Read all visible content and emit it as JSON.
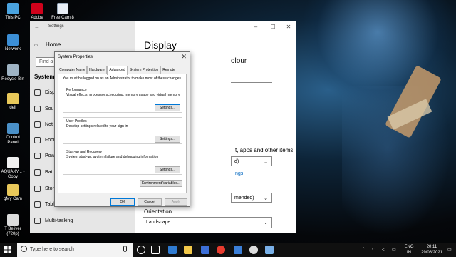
{
  "desktop": {
    "icons": [
      {
        "label": "This PC"
      },
      {
        "label": "Adobe"
      },
      {
        "label": "Free Cam 8"
      },
      {
        "label": "Network"
      },
      {
        "label": "Recycle Bin"
      },
      {
        "label": "dell"
      },
      {
        "label": "Control Panel"
      },
      {
        "label": "AQUAXY... - Copy"
      },
      {
        "label": "gMy Cam"
      },
      {
        "label": "T Beliver (720p)"
      }
    ]
  },
  "settings": {
    "window_title": "Settings",
    "home": "Home",
    "find_placeholder": "Find a s",
    "section": "System",
    "items": [
      "Disp",
      "Sou",
      "Noti",
      "Focu",
      "Pow",
      "Batt",
      "Stor",
      "Tabl",
      "Multi-tasking"
    ],
    "content": {
      "title": "Display",
      "colour_text": "olour",
      "apps_text": "t, apps and other items",
      "scale_value": "d)",
      "link_text": "ngs",
      "resolution_value": "mended)",
      "orientation_label": "Orientation",
      "orientation_value": "Landscape"
    }
  },
  "dialog": {
    "title": "System Properties",
    "close": "✕",
    "tabs": [
      "Computer Name",
      "Hardware",
      "Advanced",
      "System Protection",
      "Remote"
    ],
    "active_tab": "Advanced",
    "notice": "You must be logged on as an Administrator to make most of these changes.",
    "performance": {
      "title": "Performance",
      "desc": "Visual effects, processor scheduling, memory usage and virtual memory",
      "button": "Settings..."
    },
    "profiles": {
      "title": "User Profiles",
      "desc": "Desktop settings related to your sign-in",
      "button": "Settings..."
    },
    "startup": {
      "title": "Start-up and Recovery",
      "desc": "System start-up, system failure and debugging information",
      "button": "Settings..."
    },
    "env_button": "Environment Variables...",
    "ok": "OK",
    "cancel": "Cancel",
    "apply": "Apply"
  },
  "taskbar": {
    "search_placeholder": "Type here to search",
    "lang_top": "ENG",
    "lang_bottom": "IN",
    "time": "20:11",
    "date": "29/08/2021"
  }
}
